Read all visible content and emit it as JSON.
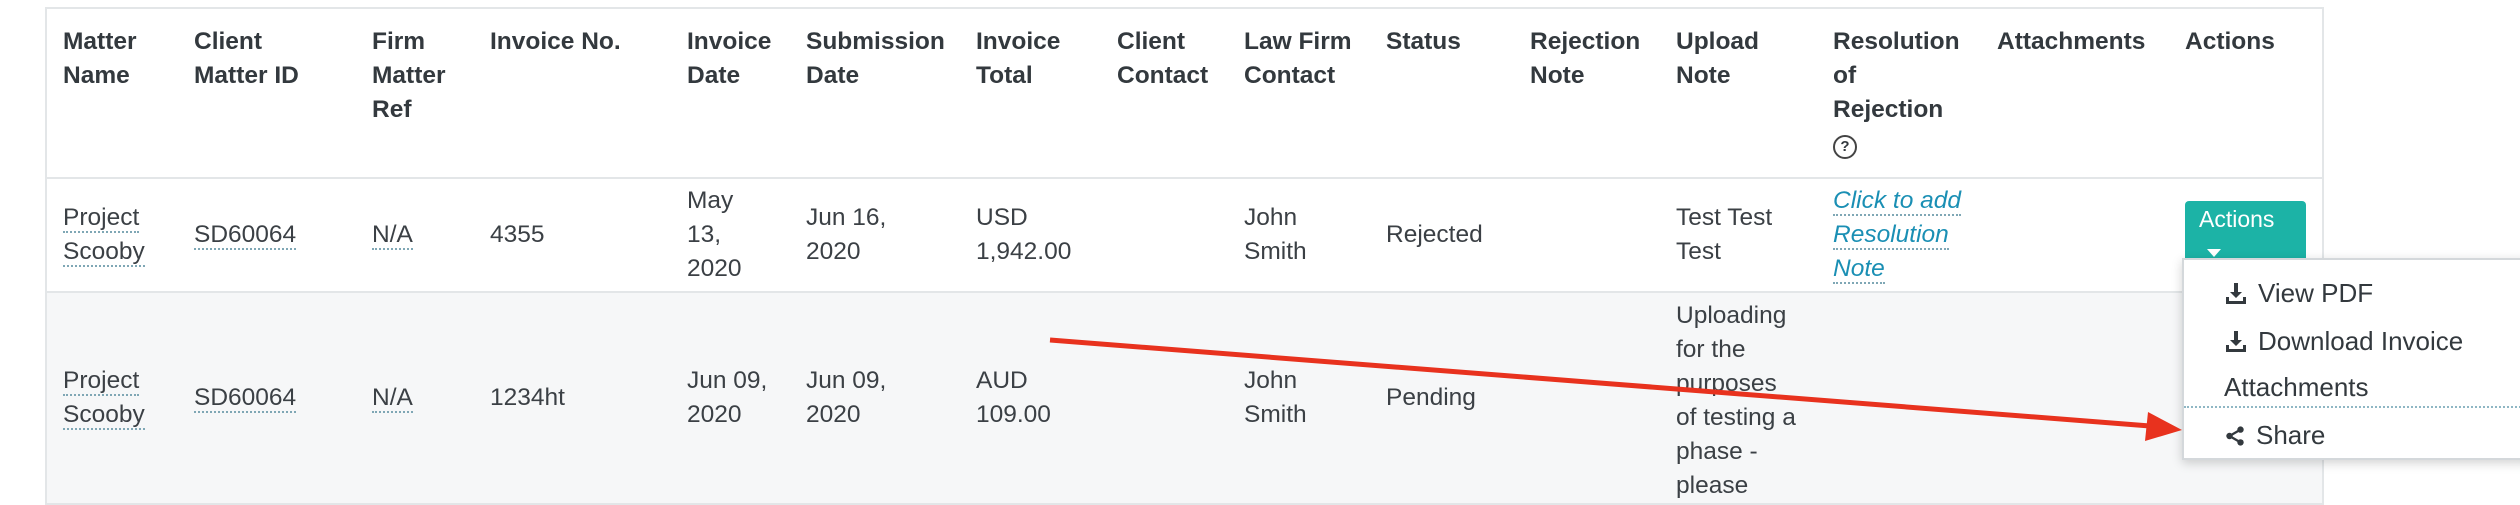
{
  "columns": [
    "Matter Name",
    "Client Matter ID",
    "Firm Matter Ref",
    "Invoice No.",
    "Invoice Date",
    "Submission Date",
    "Invoice Total",
    "Client Contact",
    "Law Firm Contact",
    "Status",
    "Rejection Note",
    "Upload Note",
    "Resolution of Rejection",
    "Attachments",
    "Actions"
  ],
  "rows": [
    {
      "matter_name": "Project Scooby",
      "client_matter_id": "SD60064",
      "firm_matter_ref": "N/A",
      "invoice_no": "4355",
      "invoice_date": "May 13, 2020",
      "submission_date": "Jun 16, 2020",
      "invoice_total": "USD 1,942.00",
      "client_contact": "",
      "law_firm_contact": "John Smith",
      "status": "Rejected",
      "rejection_note": "",
      "upload_note": "Test Test Test",
      "resolution": "Click to add Resolution Note",
      "attachments": "",
      "actions_label": "Actions"
    },
    {
      "matter_name": "Project Scooby",
      "client_matter_id": "SD60064",
      "firm_matter_ref": "N/A",
      "invoice_no": "1234ht",
      "invoice_date": "Jun 09, 2020",
      "submission_date": "Jun 09, 2020",
      "invoice_total": "AUD 109.00",
      "client_contact": "",
      "law_firm_contact": "John Smith",
      "status": "Pending",
      "rejection_note": "",
      "upload_note": "Uploading for the purposes of testing a phase - please",
      "resolution": "",
      "attachments": "",
      "actions_label": ""
    }
  ],
  "actions_menu": {
    "items": [
      "View PDF",
      "Download Invoice",
      "Attachments",
      "Share"
    ],
    "icons": [
      "download-icon",
      "download-icon",
      "",
      "share-icon"
    ]
  },
  "help_glyph": "?",
  "colors": {
    "accent": "#1cb3a6",
    "link": "#1a8fb4",
    "arrow": "#e8321e"
  }
}
